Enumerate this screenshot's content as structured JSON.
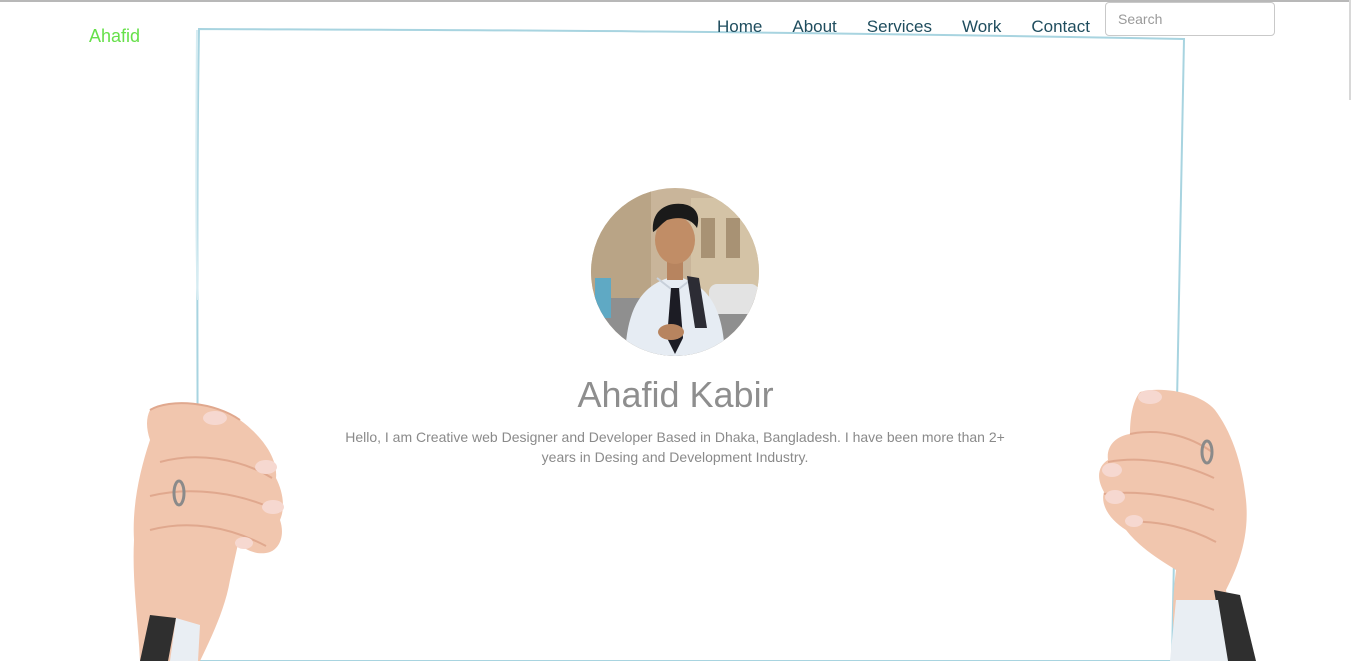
{
  "header": {
    "brand": "Ahafid",
    "nav": [
      {
        "label": "Home"
      },
      {
        "label": "About"
      },
      {
        "label": "Services"
      },
      {
        "label": "Work"
      },
      {
        "label": "Contact"
      }
    ],
    "search": {
      "placeholder": "Search",
      "value": ""
    }
  },
  "hero": {
    "name": "Ahafid Kabir",
    "bio": "Hello, I am Creative web Designer and Developer Based in Dhaka, Bangladesh. I have been more than 2+ years in Desing and Development Industry."
  },
  "colors": {
    "brand": "#66e04a",
    "nav": "#1f4d5e",
    "name": "#8e8e8e",
    "paper_edge": "#a8d4e0"
  }
}
